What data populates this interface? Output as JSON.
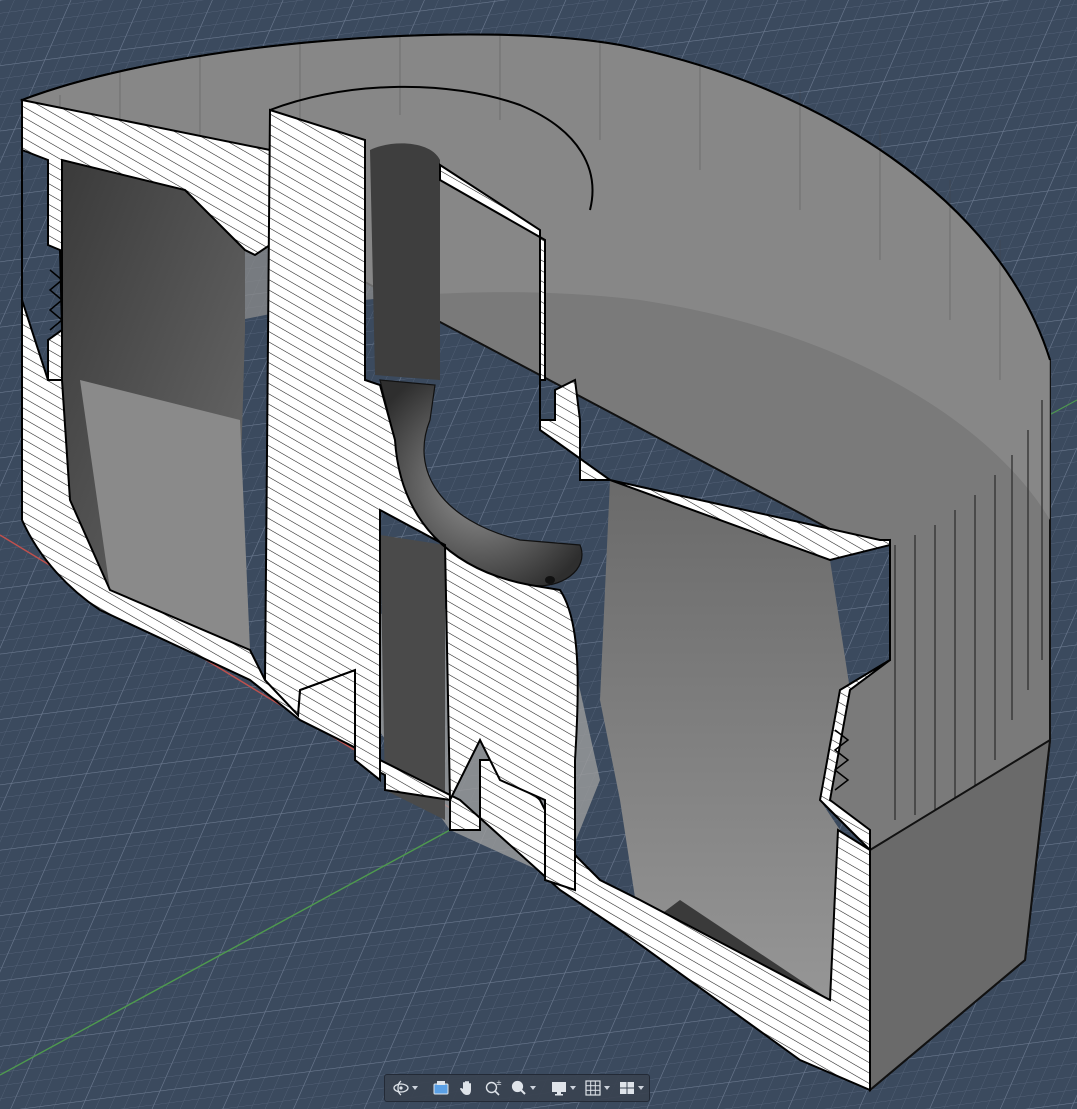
{
  "viewport": {
    "background": "#3b4a5e",
    "grid_minor_color": "#56647a",
    "grid_major_color": "#6c7a90",
    "x_axis_color": "#c0504d",
    "y_axis_color": "#4e9a4e",
    "model_fill": "#7d7d7d",
    "hatch_color": "#1a1a1a"
  },
  "toolbar": {
    "tools": [
      {
        "name": "orbit",
        "icon": "orbit-icon",
        "has_dropdown": true
      },
      {
        "name": "look-at",
        "icon": "look-at-icon",
        "has_dropdown": false
      },
      {
        "name": "pan",
        "icon": "pan-hand-icon",
        "has_dropdown": false
      },
      {
        "name": "zoom",
        "icon": "zoom-plus-minus-icon",
        "has_dropdown": false
      },
      {
        "name": "fit",
        "icon": "zoom-window-icon",
        "has_dropdown": true
      },
      {
        "name": "display-settings",
        "icon": "display-monitor-icon",
        "has_dropdown": true
      },
      {
        "name": "grid-and-snaps",
        "icon": "grid-icon",
        "has_dropdown": true
      },
      {
        "name": "viewports",
        "icon": "viewports-icon",
        "has_dropdown": true
      }
    ]
  }
}
